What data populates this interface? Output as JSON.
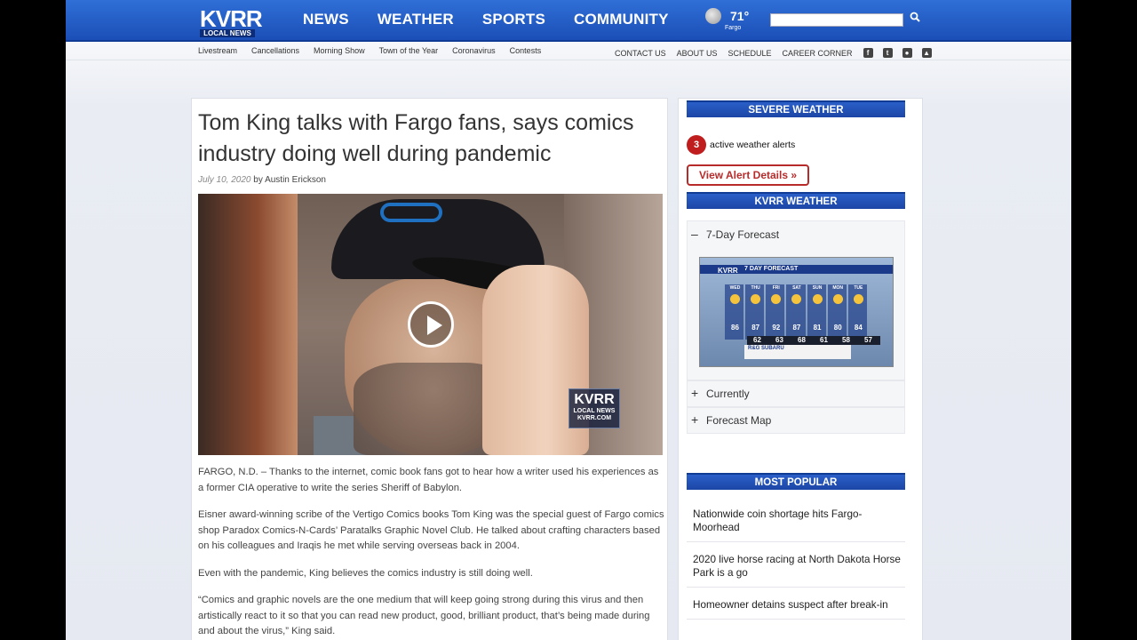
{
  "header": {
    "logo_big": "KVRR",
    "logo_small": "LOCAL NEWS",
    "nav": [
      "NEWS",
      "WEATHER",
      "SPORTS",
      "COMMUNITY"
    ],
    "temp": "71°",
    "city": "Fargo",
    "search_placeholder": ""
  },
  "subnav": [
    "Livestream",
    "Cancellations",
    "Morning Show",
    "Town of the Year",
    "Coronavirus",
    "Contests"
  ],
  "rightnav": [
    "CONTACT US",
    "ABOUT US",
    "SCHEDULE",
    "CAREER CORNER"
  ],
  "social_icons": [
    "facebook-icon",
    "twitter-icon",
    "apple-icon",
    "android-icon"
  ],
  "article": {
    "headline": "Tom King talks with Fargo fans, says comics industry doing well during pandemic",
    "date": "July 10, 2020",
    "by": "by",
    "author": "Austin Erickson",
    "video_bug": {
      "big": "KVRR",
      "mid": "LOCAL NEWS",
      "small": "KVRR.COM"
    },
    "paragraphs": [
      "FARGO, N.D. – Thanks to the internet, comic book fans got to hear how a writer used his experiences as a former CIA operative to write the series Sheriff of Babylon.",
      "Eisner award-winning scribe of the Vertigo Comics books Tom King was the special guest of Fargo comics shop Paradox Comics-N-Cards’ Paratalks Graphic Novel Club. He talked about crafting characters based on his colleagues and Iraqis he met while serving overseas back in 2004.",
      "Even with the pandemic, King believes the comics industry is still doing well.",
      "“Comics and graphic novels are the one medium that will keep going strong during this virus and then artistically react to it so that you can read new product, good, brilliant product, that’s being made during and about the virus,” King said."
    ]
  },
  "sidebar": {
    "severe_title": "SEVERE WEATHER",
    "alert_count": "3",
    "alert_text": "active weather alerts",
    "alert_button": "View Alert Details »",
    "weather_title": "KVRR WEATHER",
    "accordion": [
      {
        "sign": "–",
        "label": "7-Day Forecast"
      },
      {
        "sign": "+",
        "label": "Currently"
      },
      {
        "sign": "+",
        "label": "Forecast Map"
      }
    ],
    "forecast_graphic": {
      "logo": "KVRR",
      "title": "7 DAY FORECAST",
      "days": [
        "WED",
        "THU",
        "FRI",
        "SAT",
        "SUN",
        "MON",
        "TUE"
      ],
      "highs": [
        "86",
        "87",
        "92",
        "87",
        "81",
        "80",
        "84"
      ],
      "lows": [
        "62",
        "63",
        "68",
        "61",
        "58",
        "57"
      ],
      "sponsor": "R&G SUBARU"
    },
    "popular_title": "MOST POPULAR",
    "popular": [
      "Nationwide coin shortage hits Fargo-Moorhead",
      "2020 live horse racing at North Dakota Horse Park is a go",
      "Homeowner detains suspect after break-in"
    ]
  }
}
